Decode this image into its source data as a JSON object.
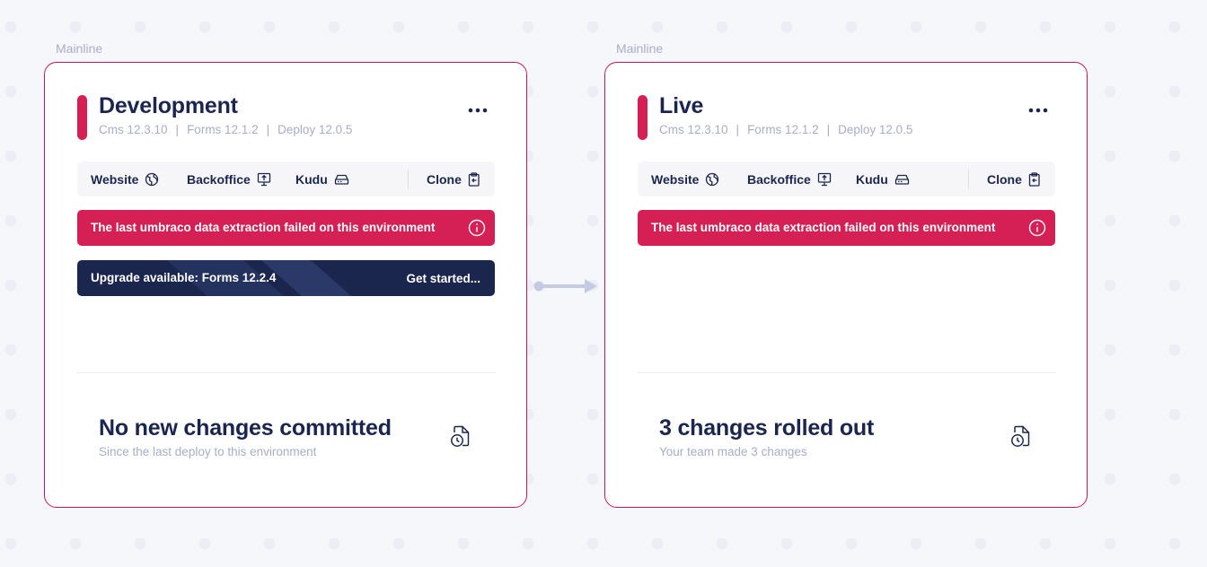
{
  "pipeline": {
    "environments": [
      {
        "lane_label": "Mainline",
        "name": "Development",
        "accent_color": "#d42054",
        "versions": {
          "cms": "Cms 12.3.10",
          "forms": "Forms 12.1.2",
          "deploy": "Deploy 12.0.5"
        },
        "toolbar": {
          "website": "Website",
          "backoffice": "Backoffice",
          "kudu": "Kudu",
          "clone": "Clone"
        },
        "alert": "The last umbraco data extraction failed on this environment",
        "upgrade": {
          "text": "Upgrade available: Forms 12.2.4",
          "action": "Get started..."
        },
        "changes_title": "No new changes committed",
        "changes_subtitle": "Since the last deploy to this environment"
      },
      {
        "lane_label": "Mainline",
        "name": "Live",
        "accent_color": "#d42054",
        "versions": {
          "cms": "Cms 12.3.10",
          "forms": "Forms 12.1.2",
          "deploy": "Deploy 12.0.5"
        },
        "toolbar": {
          "website": "Website",
          "backoffice": "Backoffice",
          "kudu": "Kudu",
          "clone": "Clone"
        },
        "alert": "The last umbraco data extraction failed on this environment",
        "changes_title": "3 changes rolled out",
        "changes_subtitle": "Your team made 3 changes"
      }
    ]
  },
  "icons": {
    "more": "more-options-icon",
    "website": "globe-icon",
    "backoffice": "monitor-upload-icon",
    "kudu": "server-icon",
    "clone": "clipboard-copy-icon",
    "alert": "info-icon",
    "history": "document-history-icon",
    "flow": "arrow-right-icon"
  },
  "colors": {
    "alert_bg": "#d42054",
    "upgrade_bg": "#1b264f",
    "card_border": "#c8175b",
    "text_primary": "#1b264f",
    "text_muted": "#a9adc7"
  }
}
